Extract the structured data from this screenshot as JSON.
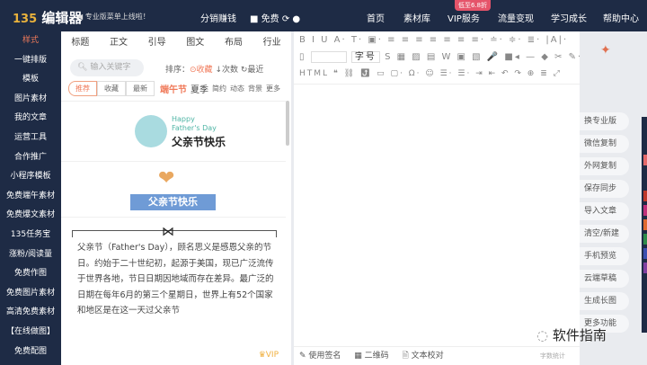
{
  "header": {
    "logo": "135",
    "logo_text": "编辑器",
    "promo": "◀ 专业版菜单上线啦！",
    "distribute": "分销赚钱",
    "free_label": "免费",
    "discount_badge": "低至6.8折",
    "nav": [
      "首页",
      "素材库",
      "VIP服务",
      "流量变现",
      "学习成长",
      "帮助中心"
    ]
  },
  "sidebar": {
    "items": [
      "样式",
      "一键排版",
      "模板",
      "图片素材",
      "我的文章",
      "运营工具",
      "合作推广",
      "小程序模板",
      "免费端午素材",
      "免费爆文素材",
      "135任务宝",
      "涨粉/阅读量",
      "免费作图",
      "免费图片素材",
      "高清免费素材",
      "【在线做图】",
      "免费配图"
    ]
  },
  "templates": {
    "tabs": [
      "标题",
      "正文",
      "引导",
      "图文",
      "布局",
      "行业"
    ],
    "search_placeholder": "输入关键字",
    "sort_label": "排序：",
    "sort_options": [
      "⊙收藏",
      "↓次数",
      "↻最近"
    ],
    "filters": [
      "推荐",
      "收藏",
      "最新"
    ],
    "hot_tag": "端午节",
    "tags": [
      "夏季",
      "简约",
      "动态",
      "背景",
      "更多"
    ],
    "card1": {
      "en1": "Happy",
      "en2": "Father's Day",
      "cn": "父亲节快乐"
    },
    "card2": {
      "ribbon": "父亲节快乐"
    },
    "card3": {
      "text": "父亲节（Father's Day），顾名思义是感恩父亲的节日。约始于二十世纪初，起源于美国，现已广泛流传于世界各地，节日日期因地域而存在差异。最广泛的日期在每年6月的第三个星期日，世界上有52个国家和地区是在这一天过父亲节"
    },
    "vip": "♛VIP"
  },
  "editor": {
    "toolbar_row1": "B I U A· T· ▣· ≡ ≡ ≡ ≡ ≡ ≡ ≡· ≐· ≑· ≣· |A|·",
    "font_size": "字号",
    "toolbar_row2": "S ▦ ▨ ▤ W ▣ ▧ 🎤 ■◂ — ◆ ✂ ✎·",
    "toolbar_row3": "HTML ❝ ⛓ ⤴ ▭ ▢· Ω· ☺ ☰· ☰· ⇥ ⇤ ↶ ↷ ⊕ ≣   ⤢",
    "footer": [
      "✎ 使用签名",
      "▦ 二维码",
      "🗎 文本校对"
    ],
    "word_count": "字数统计"
  },
  "actions": [
    "换专业版",
    "微信复制",
    "外网复制",
    "保存同步",
    "导入文章",
    "清空/新建",
    "手机预览",
    "云端草稿",
    "生成长图",
    "更多功能"
  ],
  "watermark": "软件指南",
  "colors": {
    "navy": "#1e2b45",
    "accent": "#f07a5a"
  }
}
